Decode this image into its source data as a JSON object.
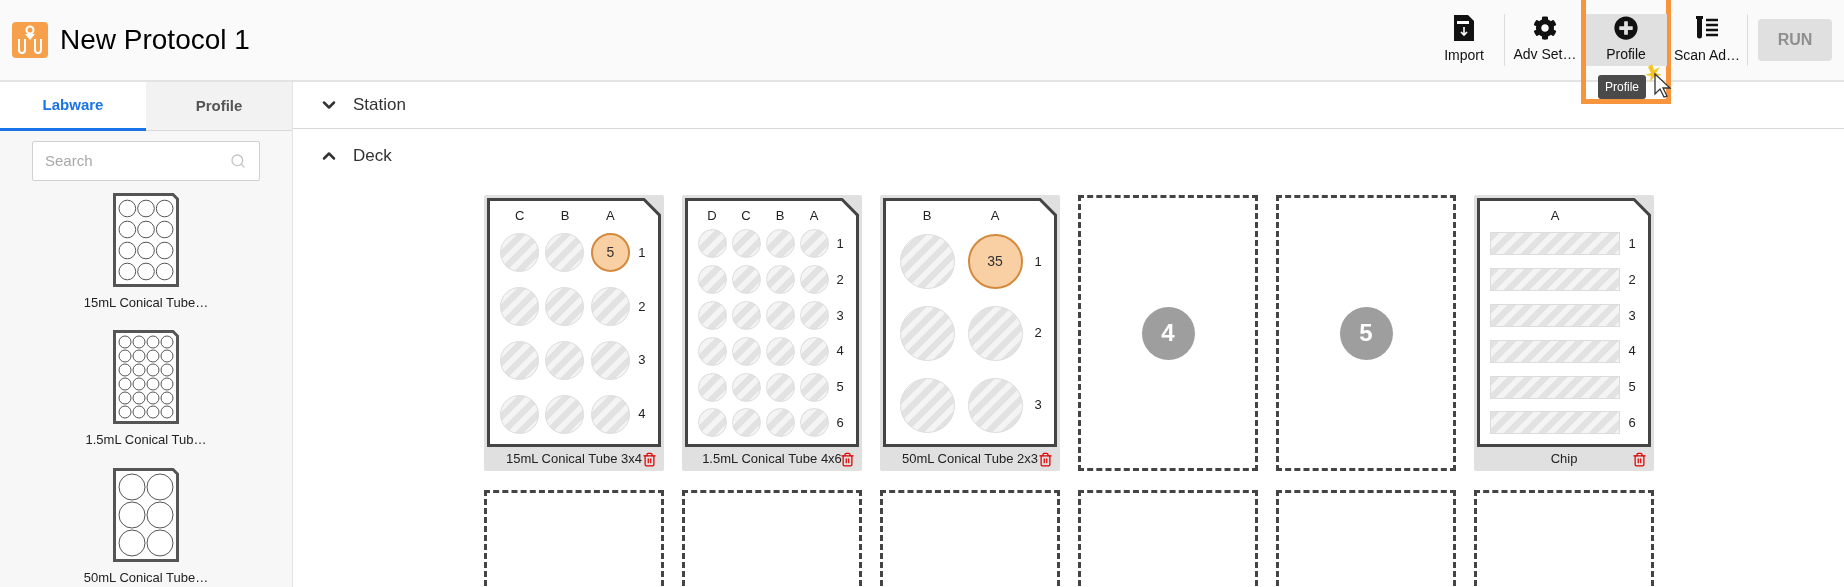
{
  "header": {
    "title": "New Protocol 1",
    "toolbar": [
      {
        "kind": "csv",
        "label": "Import",
        "highlighted": false
      },
      {
        "kind": "gear",
        "label": "Adv Set…",
        "highlighted": false
      },
      {
        "kind": "plus",
        "label": "Profile",
        "highlighted": true,
        "tooltip": "Profile"
      },
      {
        "kind": "tubes",
        "label": "Scan Ad…",
        "highlighted": false
      }
    ],
    "run_button": {
      "label": "RUN",
      "disabled": true
    }
  },
  "sidebar": {
    "tabs": [
      {
        "label": "Labware",
        "selected": true
      },
      {
        "label": "Profile",
        "selected": false
      }
    ],
    "search": {
      "placeholder": "Search"
    },
    "labware": [
      {
        "kind": "rack12",
        "label": "15mL Conical Tube…"
      },
      {
        "kind": "rack24",
        "label": "1.5mL Conical Tub…"
      },
      {
        "kind": "rack6",
        "label": "50mL Conical Tube…"
      }
    ]
  },
  "sections": [
    {
      "label": "Station",
      "expanded": false
    },
    {
      "label": "Deck",
      "expanded": true
    }
  ],
  "deck": {
    "slots": [
      {
        "kind": "rack15",
        "name": "15mL Conical Tube 3x4",
        "columns": [
          "C",
          "B",
          "A"
        ],
        "rows": [
          {
            "label": "1",
            "wells": [
              {
                "filled": false
              },
              {
                "filled": false
              },
              {
                "filled": true,
                "label": "5"
              }
            ]
          },
          {
            "label": "2",
            "wells": [
              {
                "filled": false
              },
              {
                "filled": false
              },
              {
                "filled": false
              }
            ]
          },
          {
            "label": "3",
            "wells": [
              {
                "filled": false
              },
              {
                "filled": false
              },
              {
                "filled": false
              }
            ]
          },
          {
            "label": "4",
            "wells": [
              {
                "filled": false
              },
              {
                "filled": false
              },
              {
                "filled": false
              }
            ]
          }
        ]
      },
      {
        "kind": "rack1_5",
        "name": "1.5mL Conical Tube 4x6",
        "columns": [
          "D",
          "C",
          "B",
          "A"
        ],
        "rows": [
          {
            "label": "1",
            "wells": [
              {
                "filled": false
              },
              {
                "filled": false
              },
              {
                "filled": false
              },
              {
                "filled": false
              }
            ]
          },
          {
            "label": "2",
            "wells": [
              {
                "filled": false
              },
              {
                "filled": false
              },
              {
                "filled": false
              },
              {
                "filled": false
              }
            ]
          },
          {
            "label": "3",
            "wells": [
              {
                "filled": false
              },
              {
                "filled": false
              },
              {
                "filled": false
              },
              {
                "filled": false
              }
            ]
          },
          {
            "label": "4",
            "wells": [
              {
                "filled": false
              },
              {
                "filled": false
              },
              {
                "filled": false
              },
              {
                "filled": false
              }
            ]
          },
          {
            "label": "5",
            "wells": [
              {
                "filled": false
              },
              {
                "filled": false
              },
              {
                "filled": false
              },
              {
                "filled": false
              }
            ]
          },
          {
            "label": "6",
            "wells": [
              {
                "filled": false
              },
              {
                "filled": false
              },
              {
                "filled": false
              },
              {
                "filled": false
              }
            ]
          }
        ]
      },
      {
        "kind": "rack50",
        "name": "50mL Conical Tube 2x3",
        "columns": [
          "B",
          "A"
        ],
        "rows": [
          {
            "label": "1",
            "wells": [
              {
                "filled": false
              },
              {
                "filled": true,
                "label": "35"
              }
            ]
          },
          {
            "label": "2",
            "wells": [
              {
                "filled": false
              },
              {
                "filled": false
              }
            ]
          },
          {
            "label": "3",
            "wells": [
              {
                "filled": false
              },
              {
                "filled": false
              }
            ]
          }
        ]
      },
      {
        "kind": "empty",
        "number": "4"
      },
      {
        "kind": "empty",
        "number": "5"
      },
      {
        "kind": "chip",
        "name": "Chip",
        "columns": [
          "A"
        ],
        "rows": [
          {
            "label": "1",
            "wells": [
              {
                "filled": false
              }
            ]
          },
          {
            "label": "2",
            "wells": [
              {
                "filled": false
              }
            ]
          },
          {
            "label": "3",
            "wells": [
              {
                "filled": false
              }
            ]
          },
          {
            "label": "4",
            "wells": [
              {
                "filled": false
              }
            ]
          },
          {
            "label": "5",
            "wells": [
              {
                "filled": false
              }
            ]
          },
          {
            "label": "6",
            "wells": [
              {
                "filled": false
              }
            ]
          }
        ]
      },
      {
        "kind": "empty"
      },
      {
        "kind": "empty"
      },
      {
        "kind": "empty"
      },
      {
        "kind": "empty"
      },
      {
        "kind": "empty"
      },
      {
        "kind": "empty"
      }
    ]
  }
}
